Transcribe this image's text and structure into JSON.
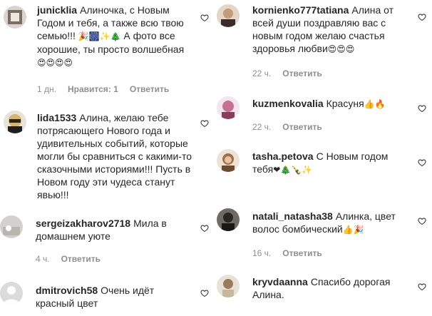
{
  "colors": {
    "text": "#262626",
    "meta": "#8e8e8e",
    "background": "#ffffff"
  },
  "icons": {
    "like": "heart-outline-icon"
  },
  "comments_left": [
    {
      "username": "junicklia",
      "text": "Алиночка, с Новым Годом и тебя, а также всю твою семью!!!",
      "emoji_1": "🎉🎆✨🎄",
      "text_2": "А фото все хорошие, ты просто волшебная",
      "emoji_2": "😍😍😍😍",
      "time": "1 дн.",
      "likes": "Нравится: 1",
      "reply": "Ответить"
    },
    {
      "username": "lida1533",
      "text": "Алина, желаю тебе потрясающего Нового года и удивительных событий, которые могли бы сравниться с какими-то сказочными историями!!! Пусть в Новом году эти чудеса станут явью!!!",
      "time": "",
      "reply": ""
    },
    {
      "username": "sergeizakharov2718",
      "text": "Мила в домашнем уюте",
      "time": "4 ч.",
      "reply": "Ответить"
    },
    {
      "username": "dmitrovich58",
      "text": "Очень идёт красный цвет",
      "time": "",
      "reply": ""
    }
  ],
  "comments_right": [
    {
      "username": "kornienko777tatiana",
      "text": "Алина от всей души поздравляю вас с новым годом желаю счастья здоровья любви",
      "emoji": "😍😍😍",
      "time": "22 ч.",
      "reply": "Ответить"
    },
    {
      "username": "kuzmenkovalia",
      "text": "Красуня",
      "emoji": "👍🔥",
      "time": "22 ч.",
      "reply": "Ответить"
    },
    {
      "username": "tasha.petova",
      "text": "С Новым годом тебя",
      "emoji": "❤🎄🍾✨",
      "time": "",
      "reply": ""
    },
    {
      "username": "natali_natasha38",
      "text": "Алинка, цвет волос бомбический",
      "emoji": "👍🎉",
      "time": "16 ч.",
      "reply": "Ответить"
    },
    {
      "username": "kryvdaanna",
      "text": "Спасибо дорогая Алина.",
      "time": "",
      "reply": ""
    }
  ]
}
